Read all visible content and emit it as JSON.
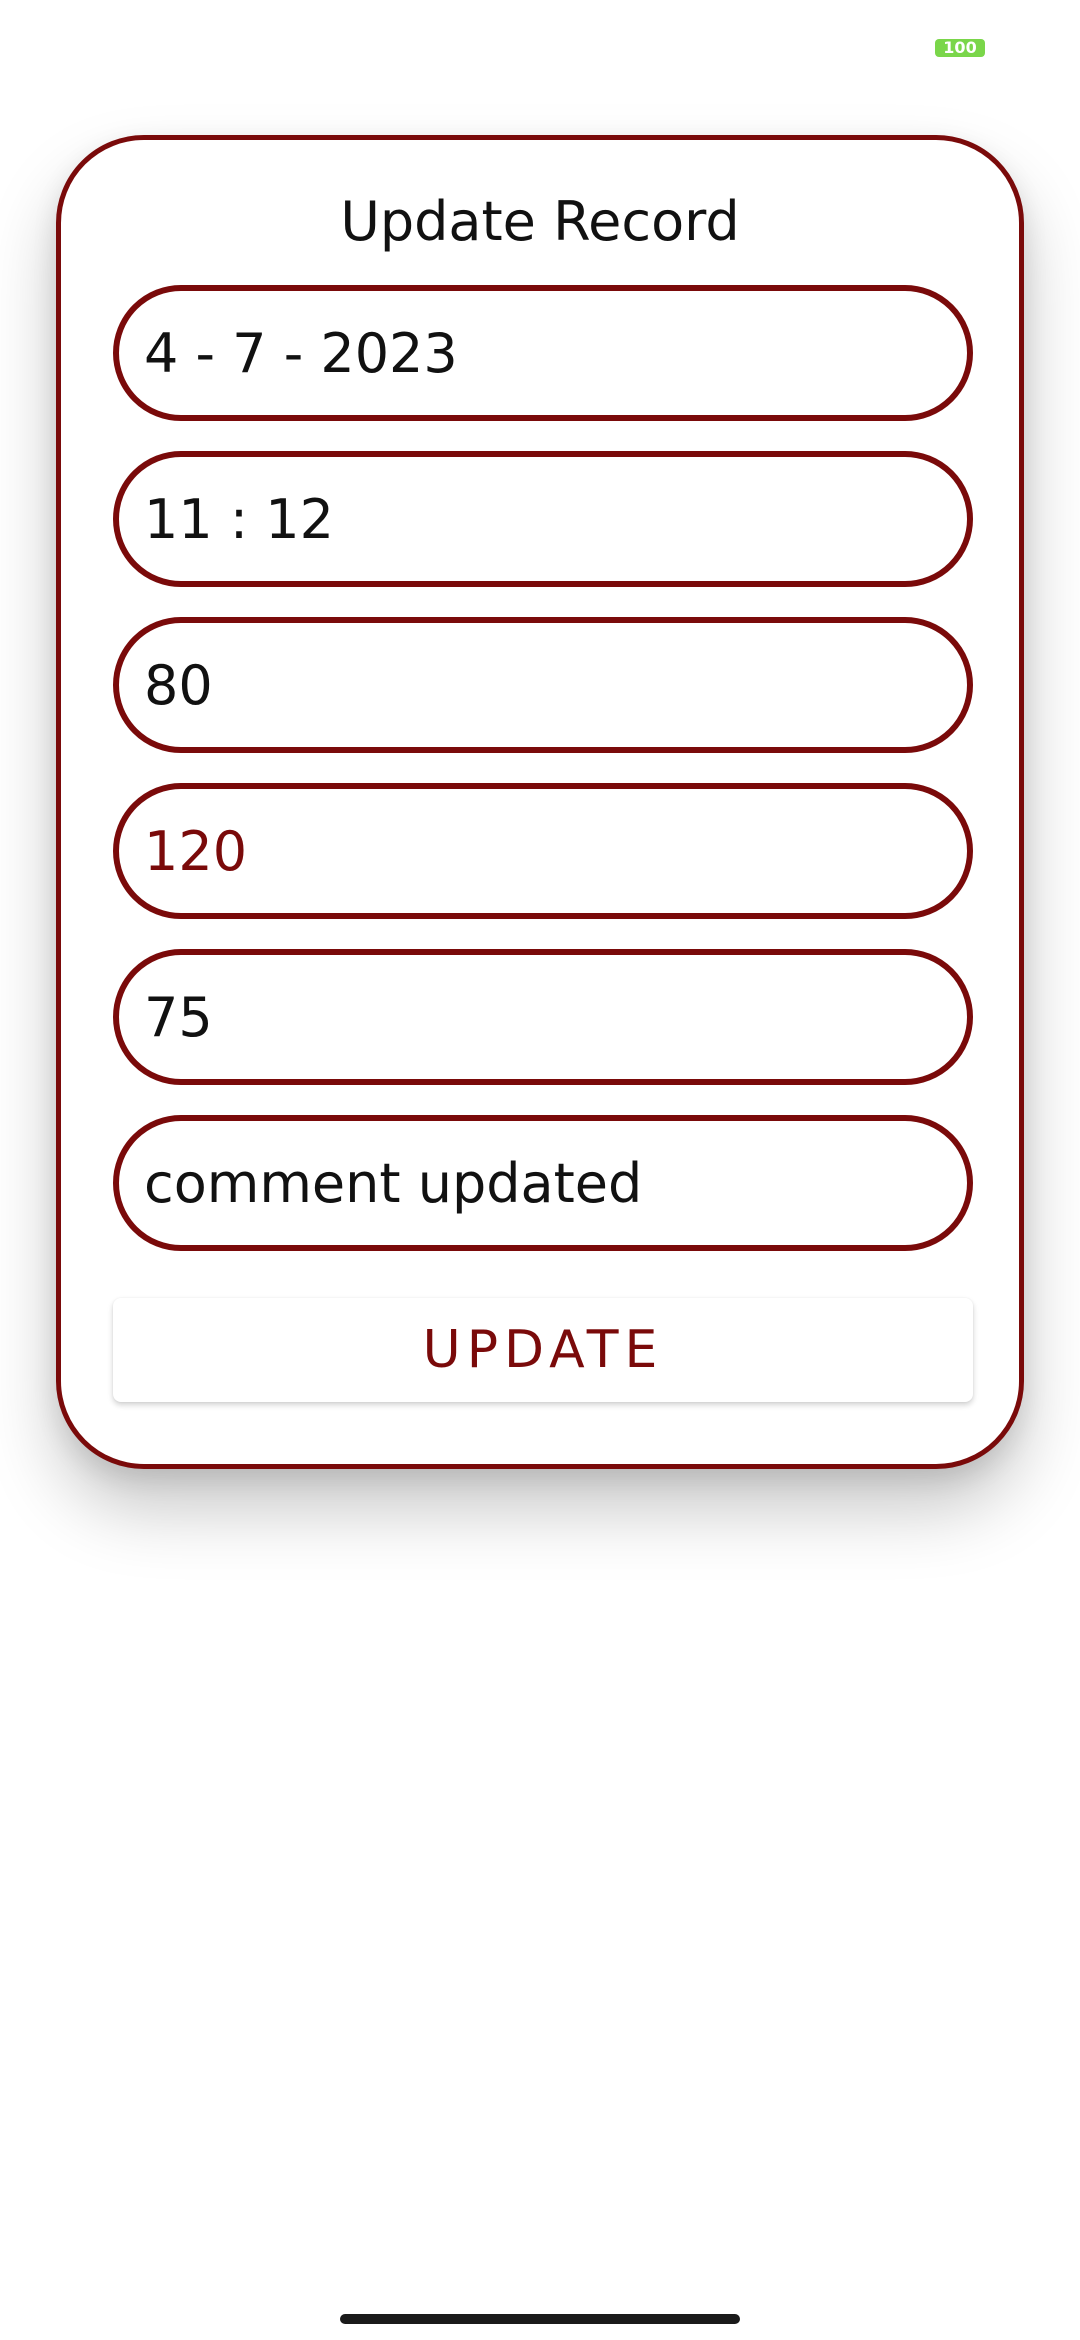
{
  "status_bar": {
    "battery_level": "100",
    "battery_color": "#7ad64a"
  },
  "form": {
    "title": "Update Record",
    "fields": [
      {
        "name": "date",
        "value": "4 - 7 - 2023"
      },
      {
        "name": "time",
        "value": "11 : 12"
      },
      {
        "name": "value-1",
        "value": "80"
      },
      {
        "name": "value-2",
        "value": "120"
      },
      {
        "name": "value-3",
        "value": "75"
      },
      {
        "name": "comment",
        "value": "comment updated"
      }
    ],
    "update_label": "UPDATE"
  },
  "colors": {
    "accent": "#7a0a0a",
    "background": "#ffffff",
    "text": "#111111"
  }
}
